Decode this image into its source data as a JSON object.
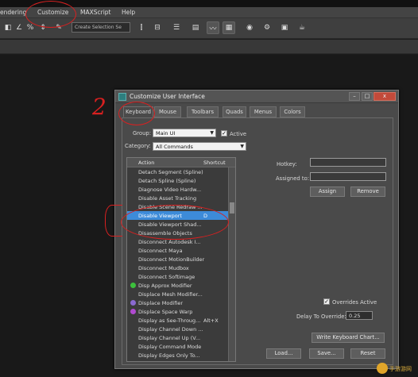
{
  "menubar": {
    "items": [
      "endering",
      "Customize",
      "MAXScript",
      "Help"
    ]
  },
  "toolbar": {
    "selection_set_placeholder": "Create Selection Se",
    "icons": [
      "magnet-icon",
      "angle-snap-icon",
      "percent-snap-icon",
      "spinner-snap-icon",
      "edit-named-selection-icon",
      "mirror-icon",
      "align-icon",
      "layer-manager-icon",
      "graphite-ribbon-icon",
      "curve-editor-icon",
      "schematic-view-icon",
      "material-editor-icon",
      "render-setup-icon",
      "rendered-frame-icon",
      "render-icon"
    ]
  },
  "annotations": {
    "number_2": "2"
  },
  "dialog": {
    "title": "Customize User Interface",
    "close_label": "x",
    "tabs": [
      {
        "label": "Keyboard",
        "active": true
      },
      {
        "label": "Mouse",
        "active": false
      },
      {
        "label": "Toolbars",
        "active": false
      },
      {
        "label": "Quads",
        "active": false
      },
      {
        "label": "Menus",
        "active": false
      },
      {
        "label": "Colors",
        "active": false
      }
    ],
    "group_label": "Group:",
    "group_value": "Main UI",
    "active_label": "Active",
    "active_checked": true,
    "category_label": "Category:",
    "category_value": "All Commands",
    "list_headers": {
      "action": "Action",
      "shortcut": "Shortcut"
    },
    "rows": [
      {
        "action": "Detach Segment (Spline)",
        "shortcut": "",
        "icon": ""
      },
      {
        "action": "Detach Spline (Spline)",
        "shortcut": "",
        "icon": ""
      },
      {
        "action": "Diagnose Video Hardw...",
        "shortcut": "",
        "icon": ""
      },
      {
        "action": "Disable Asset Tracking",
        "shortcut": "",
        "icon": ""
      },
      {
        "action": "Disable Scene Redraw ...",
        "shortcut": "",
        "icon": ""
      },
      {
        "action": "Disable Viewport",
        "shortcut": "D",
        "icon": "",
        "selected": true
      },
      {
        "action": "Disable Viewport Shad...",
        "shortcut": "",
        "icon": ""
      },
      {
        "action": "Disassemble Objects",
        "shortcut": "",
        "icon": ""
      },
      {
        "action": "Disconnect Autodesk I...",
        "shortcut": "",
        "icon": ""
      },
      {
        "action": "Disconnect Maya",
        "shortcut": "",
        "icon": ""
      },
      {
        "action": "Disconnect MotionBuilder",
        "shortcut": "",
        "icon": ""
      },
      {
        "action": "Disconnect Mudbox",
        "shortcut": "",
        "icon": ""
      },
      {
        "action": "Disconnect Softimage",
        "shortcut": "",
        "icon": ""
      },
      {
        "action": "Disp Approx Modifier",
        "shortcut": "",
        "icon": "#3cc03c"
      },
      {
        "action": "Displace Mesh Modifier...",
        "shortcut": "",
        "icon": ""
      },
      {
        "action": "Displace Modifier",
        "shortcut": "",
        "icon": "#8a6ad0"
      },
      {
        "action": "Displace Space Warp",
        "shortcut": "",
        "icon": "#b04ad0"
      },
      {
        "action": "Display as See-Throug...",
        "shortcut": "Alt+X",
        "icon": ""
      },
      {
        "action": "Display Channel Down ...",
        "shortcut": "",
        "icon": ""
      },
      {
        "action": "Display Channel Up (V...",
        "shortcut": "",
        "icon": ""
      },
      {
        "action": "Display Command Mode",
        "shortcut": "",
        "icon": ""
      },
      {
        "action": "Display Edges Only To...",
        "shortcut": "",
        "icon": ""
      }
    ],
    "hotkey_label": "Hotkey:",
    "assigned_to_label": "Assigned to:",
    "assign_button": "Assign",
    "remove_button": "Remove",
    "overrides_active_label": "Overrides Active",
    "overrides_checked": true,
    "delay_label": "Delay To Override:",
    "delay_value": "0.25",
    "write_chart_button": "Write Keyboard Chart...",
    "load_button": "Load...",
    "save_button": "Save...",
    "reset_button": "Reset"
  },
  "watermark": {
    "text": "手游游网"
  }
}
